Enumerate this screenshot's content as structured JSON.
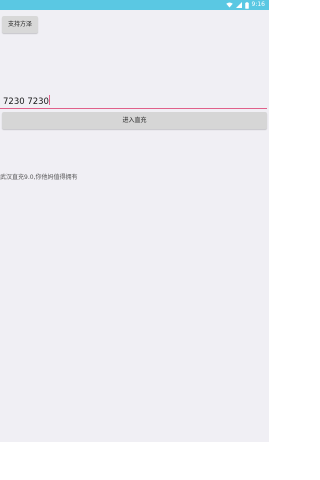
{
  "status_bar": {
    "time": "9:16",
    "color": "#5ac8e3",
    "icons": [
      "wifi-icon",
      "signal-icon",
      "battery-icon"
    ]
  },
  "toolbar": {
    "support_label": "支持方泽"
  },
  "code_input": {
    "value": "7230 7230",
    "accent": "#e0608a"
  },
  "enter_button": {
    "label": "进入直充"
  },
  "info": {
    "text": "武汉直充9.0,你他妈值得拥有"
  },
  "colors": {
    "background": "#f0eff4",
    "button": "#d6d6d6"
  }
}
